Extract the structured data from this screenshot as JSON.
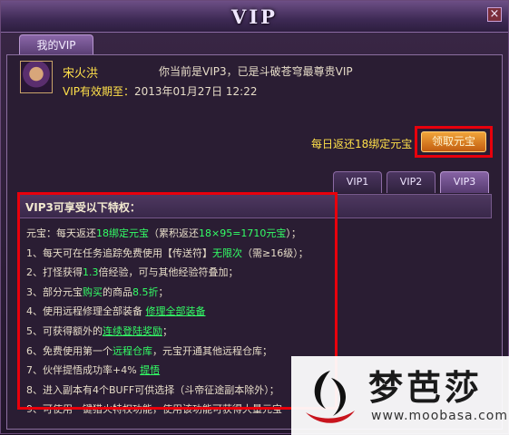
{
  "window": {
    "title": "VIP",
    "close_label": "×"
  },
  "main_tab": {
    "label": "我的VIP"
  },
  "player": {
    "name": "宋火洪",
    "status_text": "你当前是VIP3，已是斗破苍穹最尊贵VIP",
    "expiry_label": "VIP有效期至：",
    "expiry_value": "2013年01月27日 12:22"
  },
  "daily_reward": {
    "label": "每日返还18绑定元宝",
    "claim_button": "领取元宝"
  },
  "vip_tabs": [
    {
      "label": "VIP1",
      "active": false
    },
    {
      "label": "VIP2",
      "active": false
    },
    {
      "label": "VIP3",
      "active": true
    }
  ],
  "perks": {
    "title": "VIP3可享受以下特权：",
    "items": [
      [
        "元宝：每天返还",
        {
          "t": "18绑定元宝",
          "c": "hl"
        },
        "（累积返还",
        {
          "t": "18×95=1710元宝",
          "c": "hl"
        },
        "）；"
      ],
      [
        "1、每天可在任务追踪免费使用【传送符】",
        {
          "t": "无限次",
          "c": "hl"
        },
        "（需≥16级）；"
      ],
      [
        "2、打怪获得",
        {
          "t": "1.3",
          "c": "hl"
        },
        "倍经验，可与其他经验符叠加；"
      ],
      [
        "3、部分元宝",
        {
          "t": "购买",
          "c": "hl"
        },
        "的商品",
        {
          "t": "8.5折",
          "c": "hl"
        },
        "；"
      ],
      [
        "4、使用远程修理全部装备 ",
        {
          "t": "修理全部装备",
          "c": "lnk"
        }
      ],
      [
        "5、可获得额外的",
        {
          "t": "连续登陆奖励",
          "c": "lnk"
        },
        "；"
      ],
      [
        "6、免费使用第一个",
        {
          "t": "远程仓库",
          "c": "hl"
        },
        "，元宝开通其他远程仓库；"
      ],
      [
        "7、伙伴提悟成功率+4%  ",
        {
          "t": "提悟",
          "c": "lnk"
        }
      ],
      [
        "8、进入副本有4个BUFF可供选择（斗帝征途副本除外）；"
      ],
      [
        "9、可使用一键猎火特权功能，使用该功能可获得大量元宝"
      ]
    ]
  },
  "watermark": {
    "name": "梦芭莎",
    "url": "www.moobasa.com"
  },
  "colors": {
    "highlight": "#33ff66",
    "gold": "#ffe04a",
    "red_frame": "#e8000c",
    "accent": "#8663a4"
  }
}
